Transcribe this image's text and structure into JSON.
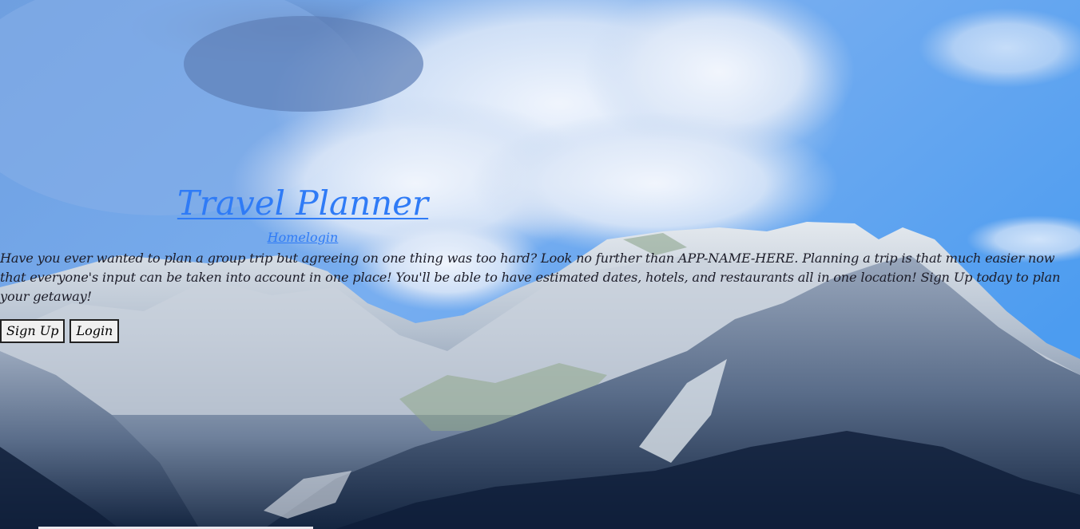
{
  "page": {
    "title": "Travel Planner",
    "nav_links": [
      "Home",
      "login"
    ],
    "intro": "Have you ever wanted to plan a group trip but agreeing on one thing was too hard? Look no further than APP-NAME-HERE. Planning a trip is that much easier now that everyone's input can be taken into account in one place! You'll be able to have estimated dates, hotels, and restaurants all in one location! Sign Up today to plan your getaway!",
    "buttons": {
      "signup_label": "Sign Up",
      "login_label": "Login"
    }
  },
  "background": {
    "subject": "mountain-range-under-cloudy-sky",
    "sky_color": "#5a9be8",
    "cloud_color": "#e9f1fc",
    "rock_color": "#b7c3d3",
    "shadow_color": "#1c2c4a"
  },
  "colors": {
    "link": "#2f7bf6",
    "text": "#1c1c28",
    "button_bg": "#f0f0f0",
    "button_border": "#222222"
  }
}
